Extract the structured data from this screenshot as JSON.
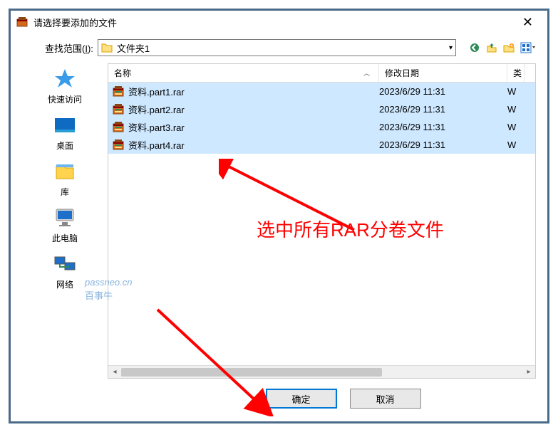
{
  "titlebar": {
    "title": "请选择要添加的文件"
  },
  "lookin": {
    "label": "查找范围(",
    "accel": "I",
    "suffix": "):",
    "folder": "文件夹1"
  },
  "sidebar": {
    "items": [
      {
        "label": "快速访问"
      },
      {
        "label": "桌面"
      },
      {
        "label": "库"
      },
      {
        "label": "此电脑"
      },
      {
        "label": "网络"
      }
    ]
  },
  "columns": {
    "name": "名称",
    "date": "修改日期",
    "type": "类"
  },
  "files": [
    {
      "name": "资料.part1.rar",
      "date": "2023/6/29 11:31",
      "type": "W"
    },
    {
      "name": "资料.part2.rar",
      "date": "2023/6/29 11:31",
      "type": "W"
    },
    {
      "name": "资料.part3.rar",
      "date": "2023/6/29 11:31",
      "type": "W"
    },
    {
      "name": "资料.part4.rar",
      "date": "2023/6/29 11:31",
      "type": "W"
    }
  ],
  "buttons": {
    "ok": "确定",
    "cancel": "取消"
  },
  "annotation": {
    "text": "选中所有RAR分卷文件"
  },
  "watermark": {
    "url": "passneo.cn",
    "brand": "百事牛"
  }
}
